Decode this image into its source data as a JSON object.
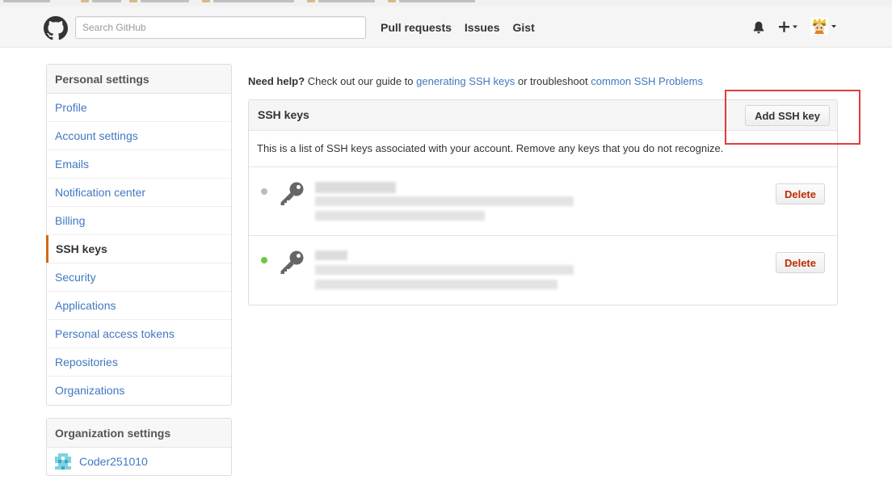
{
  "header": {
    "search_placeholder": "Search GitHub",
    "nav": [
      "Pull requests",
      "Issues",
      "Gist"
    ],
    "icons": {
      "logo": "github-octocat-icon",
      "notifications": "bell-icon",
      "create": "plus-icon",
      "user": "avatar-icon"
    }
  },
  "sidebar": {
    "heading": "Personal settings",
    "items": [
      {
        "label": "Profile",
        "selected": false
      },
      {
        "label": "Account settings",
        "selected": false
      },
      {
        "label": "Emails",
        "selected": false
      },
      {
        "label": "Notification center",
        "selected": false
      },
      {
        "label": "Billing",
        "selected": false
      },
      {
        "label": "SSH keys",
        "selected": true
      },
      {
        "label": "Security",
        "selected": false
      },
      {
        "label": "Applications",
        "selected": false
      },
      {
        "label": "Personal access tokens",
        "selected": false
      },
      {
        "label": "Repositories",
        "selected": false
      },
      {
        "label": "Organizations",
        "selected": false
      }
    ],
    "org_heading": "Organization settings",
    "org_name": "Coder251010"
  },
  "help": {
    "prefix": "Need help?",
    "text1": "Check out our guide to",
    "link1": "generating SSH keys",
    "text2": "or troubleshoot",
    "link2": "common SSH Problems"
  },
  "panel": {
    "title": "SSH keys",
    "add_button": "Add SSH key",
    "description": "This is a list of SSH keys associated with your account. Remove any keys that you do not recognize.",
    "keys": [
      {
        "status": "unused",
        "delete_label": "Delete"
      },
      {
        "status": "recent",
        "delete_label": "Delete"
      }
    ]
  },
  "colors": {
    "link": "#4078c0",
    "selected_accent": "#d26911",
    "key_inactive": "#bbbbbb",
    "key_active": "#6cc644",
    "delete_text": "#bd2c00",
    "highlight": "#e23d3d"
  }
}
